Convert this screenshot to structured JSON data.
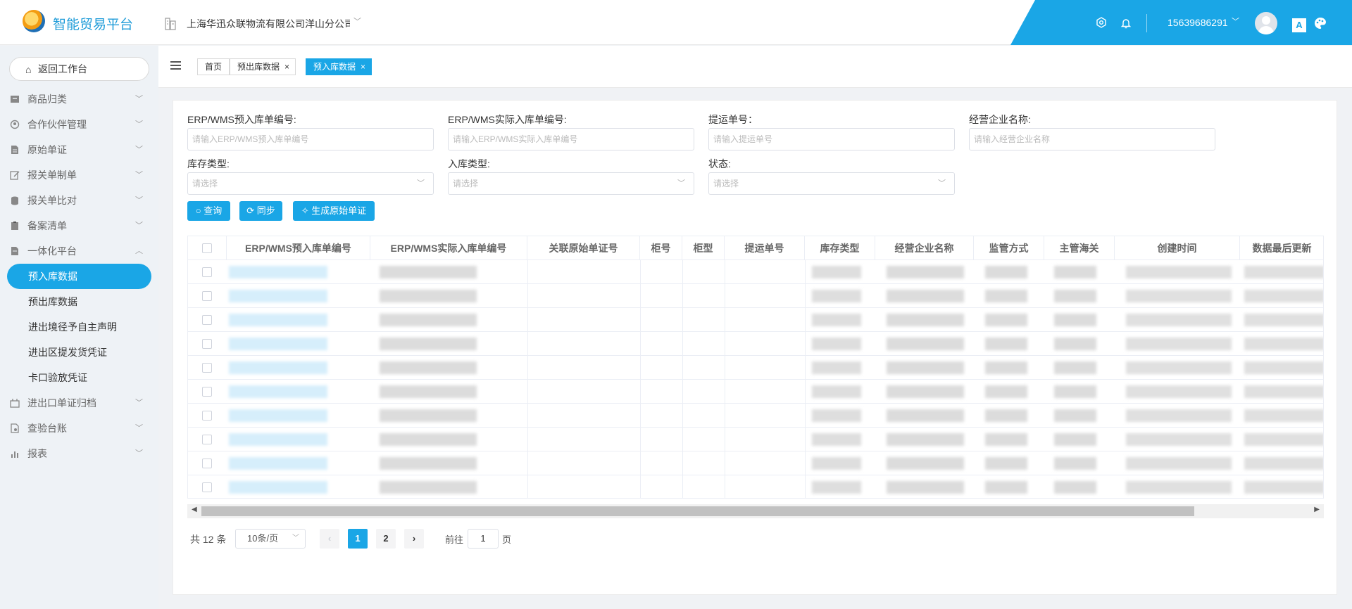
{
  "header": {
    "app_title": "智能贸易平台",
    "org_name": "上海华迅众联物流有限公司洋山分公司",
    "username": "15639686291"
  },
  "sidebar": {
    "back_label": "返回工作台",
    "items": [
      {
        "label": "商品归类"
      },
      {
        "label": "合作伙伴管理"
      },
      {
        "label": "原始单证"
      },
      {
        "label": "报关单制单"
      },
      {
        "label": "报关单比对"
      },
      {
        "label": "备案清单"
      },
      {
        "label": "一体化平台"
      }
    ],
    "sub_items": [
      {
        "label": "预入库数据"
      },
      {
        "label": "预出库数据"
      },
      {
        "label": "进出境径予自主声明"
      },
      {
        "label": "进出区提发货凭证"
      },
      {
        "label": "卡口验放凭证"
      }
    ],
    "tail_items": [
      {
        "label": "进出口单证归档"
      },
      {
        "label": "查验台账"
      },
      {
        "label": "报表"
      }
    ]
  },
  "tabs": [
    {
      "label": "首页"
    },
    {
      "label": "预出库数据"
    },
    {
      "label": "预入库数据"
    }
  ],
  "filters": {
    "erp_pre_in": {
      "label": "ERP/WMS预入库单编号:",
      "placeholder": "请输入ERP/WMS预入库单编号"
    },
    "erp_actual_in": {
      "label": "ERP/WMS实际入库单编号:",
      "placeholder": "请输入ERP/WMS实际入库单编号"
    },
    "bill_no": {
      "label": "提运单号：",
      "placeholder": "请输入提运单号"
    },
    "company": {
      "label": "经营企业名称:",
      "placeholder": "请输入经营企业名称"
    },
    "stock_type": {
      "label": "库存类型:",
      "placeholder": "请选择"
    },
    "in_type": {
      "label": "入库类型:",
      "placeholder": "请选择"
    },
    "status": {
      "label": "状态:",
      "placeholder": "请选择"
    }
  },
  "buttons": {
    "query": "查询",
    "sync": "同步",
    "generate": "生成原始单证"
  },
  "table": {
    "columns": [
      "ERP/WMS预入库单编号",
      "ERP/WMS实际入库单编号",
      "关联原始单证号",
      "柜号",
      "柜型",
      "提运单号",
      "库存类型",
      "经营企业名称",
      "监管方式",
      "主管海关",
      "创建时间",
      "数据最后更新"
    ]
  },
  "pagination": {
    "total": "共 12 条",
    "page_size": "10条/页",
    "pages": [
      "1",
      "2"
    ],
    "current_page": "1",
    "goto_label": "前往",
    "goto_value": "1",
    "goto_unit": "页"
  },
  "colors": {
    "accent": "#1aa6e6"
  },
  "icons": [
    "settings-icon",
    "bell-icon",
    "chevron-down-icon",
    "avatar",
    "translate-icon",
    "theme-icon",
    "home-icon",
    "building-icon",
    "menu-toggle-icon",
    "close-icon",
    "search-icon",
    "sync-icon",
    "magic-icon"
  ]
}
